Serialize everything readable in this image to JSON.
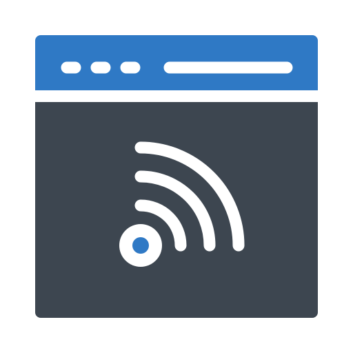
{
  "icon": {
    "name": "browser-rss-feed-icon",
    "colors": {
      "accent": "#2f79c5",
      "window_body": "#3d4650",
      "foreground": "#ffffff",
      "background": "#ffffff"
    }
  }
}
